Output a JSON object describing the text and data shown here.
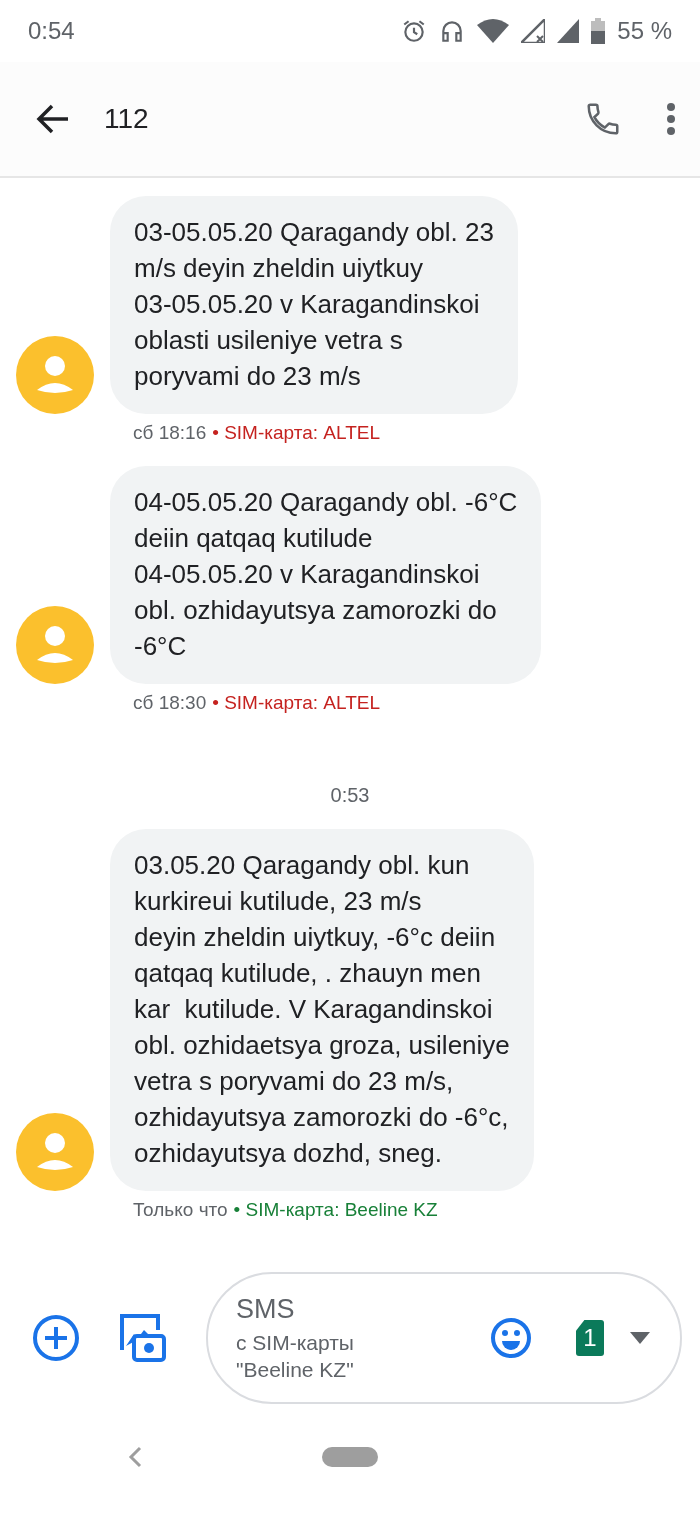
{
  "status_bar": {
    "time": "0:54",
    "battery": "55 %"
  },
  "app_bar": {
    "title": "112"
  },
  "messages": [
    {
      "kind": "message",
      "lines": [
        "03-05.05.20 Qaragandy obl. 23",
        "m/s deyin zheldin uiytkuy",
        "03-05.05.20 v Karagandinskoi",
        "oblasti usileniye vetra s",
        "poryvami do 23 m/s"
      ],
      "time": "сб 18:16",
      "sim": "• SIM-карта: ALTEL",
      "color": "#c5221f"
    },
    {
      "kind": "message",
      "lines": [
        "04-05.05.20 Qaragandy obl. -6°C",
        "deiin qatqaq kutilude",
        "04-05.05.20 v Karagandinskoi",
        "obl. ozhidayutsya zamorozki do",
        "-6°C"
      ],
      "time": "сб 18:30",
      "sim": "• SIM-карта: ALTEL",
      "color": "#c5221f"
    },
    {
      "kind": "divider",
      "time": "0:53"
    },
    {
      "kind": "message",
      "lines": [
        "03.05.20 Qaragandy obl. kun",
        "kurkireui kutilude, 23 m/s",
        "deyin zheldin uiytkuy, -6°c deiin",
        "qatqaq kutilude, . zhauyn men",
        "kar  kutilude. V Karagandinskoi",
        "obl. ozhidaetsya groza, usileniye",
        "vetra s poryvami do 23 m/s,",
        "ozhidayutsya zamorozki do -6°c,",
        "ozhidayutsya dozhd, sneg."
      ],
      "time": "Только что",
      "sim": "• SIM-карта: Beeline KZ",
      "color": "#188038"
    }
  ],
  "compose": {
    "placeholder": "SMS",
    "sim_hint": [
      "с SIM-карты",
      "\"Beeline KZ\""
    ],
    "sim_badge": "1"
  }
}
